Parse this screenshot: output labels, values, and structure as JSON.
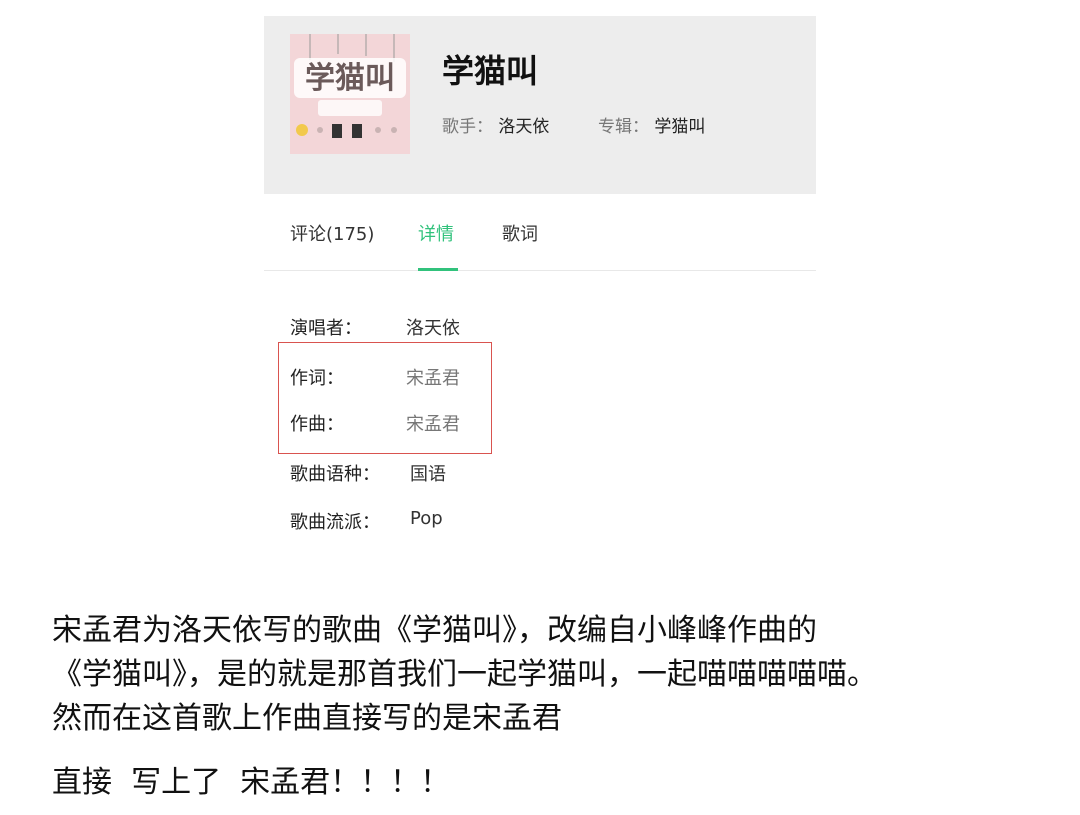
{
  "song": {
    "title": "学猫叫",
    "singer_label": "歌手：",
    "singer": "洛天依",
    "album_label": "专辑：",
    "album": "学猫叫"
  },
  "tabs": [
    {
      "label": "评论(175)",
      "active": false
    },
    {
      "label": "详情",
      "active": true
    },
    {
      "label": "歌词",
      "active": false
    }
  ],
  "details": [
    {
      "key": "演唱者：",
      "value": "洛天依"
    },
    {
      "key": "作词：",
      "value": "宋孟君"
    },
    {
      "key": "作曲：",
      "value": "宋孟君"
    },
    {
      "key": "歌曲语种：",
      "value": "国语"
    },
    {
      "key": "歌曲流派：",
      "value": "Pop"
    }
  ],
  "caption": {
    "line1": "宋孟君为洛天依写的歌曲《学猫叫》，改编自小峰峰作曲的",
    "line2": "《学猫叫》，是的就是那首我们一起学猫叫，一起喵喵喵喵喵。",
    "line3": "然而在这首歌上作曲直接写的是宋孟君",
    "line4": "直接  写上了  宋孟君！！！！"
  },
  "colors": {
    "accent": "#31c27c",
    "highlight": "#d9534f",
    "header_bg": "#ededed"
  }
}
